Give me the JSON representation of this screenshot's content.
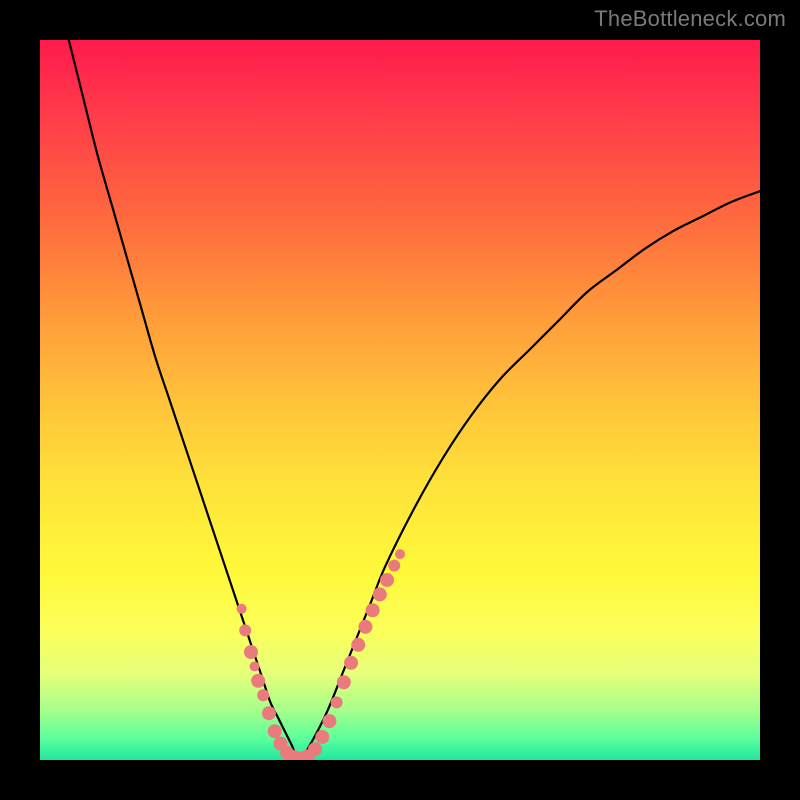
{
  "watermark": "TheBottleneck.com",
  "colors": {
    "background": "#000000",
    "curve": "#000000",
    "marker": "#e97b7d",
    "gradient_top": "#ff1a4d",
    "gradient_bottom": "#20e6a0"
  },
  "chart_data": {
    "type": "line",
    "title": "",
    "xlabel": "",
    "ylabel": "",
    "xlim": [
      0,
      100
    ],
    "ylim": [
      0,
      100
    ],
    "grid": false,
    "legend": false,
    "annotations": [
      "TheBottleneck.com"
    ],
    "series": [
      {
        "name": "bottleneck-curve-left",
        "x": [
          4,
          6,
          8,
          10,
          12,
          14,
          16,
          18,
          20,
          22,
          24,
          26,
          28,
          30,
          31,
          32,
          33,
          34,
          35,
          36
        ],
        "y": [
          100,
          92,
          84,
          77,
          70,
          63,
          56,
          50,
          44,
          38,
          32,
          26,
          20,
          14,
          11,
          8,
          6,
          4,
          2,
          0
        ]
      },
      {
        "name": "bottleneck-curve-right",
        "x": [
          36,
          38,
          40,
          42,
          44,
          46,
          48,
          52,
          56,
          60,
          64,
          68,
          72,
          76,
          80,
          84,
          88,
          92,
          96,
          100
        ],
        "y": [
          0,
          3,
          7,
          12,
          17,
          22,
          27,
          35,
          42,
          48,
          53,
          57,
          61,
          65,
          68,
          71,
          73.5,
          75.5,
          77.5,
          79
        ]
      }
    ],
    "markers": {
      "name": "highlighted-points",
      "points": [
        {
          "x": 28.0,
          "y": 21.0,
          "r": 5
        },
        {
          "x": 28.5,
          "y": 18.0,
          "r": 6
        },
        {
          "x": 29.3,
          "y": 15.0,
          "r": 7
        },
        {
          "x": 29.8,
          "y": 13.0,
          "r": 5
        },
        {
          "x": 30.3,
          "y": 11.0,
          "r": 7
        },
        {
          "x": 31.0,
          "y": 9.0,
          "r": 6
        },
        {
          "x": 31.8,
          "y": 6.5,
          "r": 7
        },
        {
          "x": 32.6,
          "y": 4.0,
          "r": 7
        },
        {
          "x": 33.4,
          "y": 2.3,
          "r": 7
        },
        {
          "x": 34.3,
          "y": 1.0,
          "r": 7
        },
        {
          "x": 35.2,
          "y": 0.4,
          "r": 7
        },
        {
          "x": 36.2,
          "y": 0.2,
          "r": 7
        },
        {
          "x": 37.2,
          "y": 0.5,
          "r": 7
        },
        {
          "x": 38.2,
          "y": 1.5,
          "r": 7
        },
        {
          "x": 39.2,
          "y": 3.2,
          "r": 7
        },
        {
          "x": 40.2,
          "y": 5.4,
          "r": 7
        },
        {
          "x": 41.2,
          "y": 8.0,
          "r": 6
        },
        {
          "x": 42.2,
          "y": 10.8,
          "r": 7
        },
        {
          "x": 43.2,
          "y": 13.5,
          "r": 7
        },
        {
          "x": 44.2,
          "y": 16.0,
          "r": 7
        },
        {
          "x": 45.2,
          "y": 18.5,
          "r": 7
        },
        {
          "x": 46.2,
          "y": 20.8,
          "r": 7
        },
        {
          "x": 47.2,
          "y": 23.0,
          "r": 7
        },
        {
          "x": 48.2,
          "y": 25.0,
          "r": 7
        },
        {
          "x": 49.2,
          "y": 27.0,
          "r": 6
        },
        {
          "x": 50.0,
          "y": 28.6,
          "r": 5
        }
      ]
    }
  }
}
